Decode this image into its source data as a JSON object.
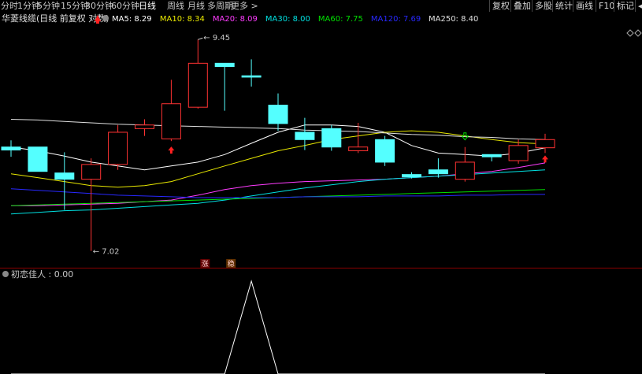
{
  "toolbar": {
    "tabs": [
      "分时",
      "1分钟",
      "5分钟",
      "15分钟",
      "30分钟",
      "60分钟",
      "日线",
      "周线",
      "月线",
      "多周期",
      "更多 >"
    ],
    "active": "日线",
    "right_buttons": [
      "复权",
      "叠加",
      "多股",
      "统计",
      "画线",
      "F10",
      "标记",
      "◀"
    ]
  },
  "chart_data": {
    "type": "candlestick",
    "title": "华菱线缆(日线 前复权 对数)",
    "scale": "log",
    "ylim": [
      6.85,
      10.05
    ],
    "grid": false,
    "candles": [
      {
        "o": 8.3,
        "h": 8.39,
        "l": 8.17,
        "c": 8.26
      },
      {
        "o": 8.3,
        "h": 8.3,
        "l": 7.98,
        "c": 7.98
      },
      {
        "o": 7.96,
        "h": 8.23,
        "l": 7.5,
        "c": 7.88
      },
      {
        "o": 7.88,
        "h": 8.15,
        "l": 7.02,
        "c": 8.07
      },
      {
        "o": 8.07,
        "h": 8.6,
        "l": 8.0,
        "c": 8.5
      },
      {
        "o": 8.55,
        "h": 8.68,
        "l": 8.45,
        "c": 8.6
      },
      {
        "o": 8.41,
        "h": 9.25,
        "l": 8.38,
        "c": 8.9
      },
      {
        "o": 8.85,
        "h": 9.87,
        "l": 8.83,
        "c": 9.5
      },
      {
        "o": 9.5,
        "h": 9.45,
        "l": 8.8,
        "c": 9.45
      },
      {
        "o": 9.31,
        "h": 9.56,
        "l": 9.15,
        "c": 9.29
      },
      {
        "o": 8.88,
        "h": 9.05,
        "l": 8.52,
        "c": 8.62
      },
      {
        "o": 8.5,
        "h": 8.7,
        "l": 8.26,
        "c": 8.4
      },
      {
        "o": 8.55,
        "h": 8.6,
        "l": 8.25,
        "c": 8.3
      },
      {
        "o": 8.25,
        "h": 8.63,
        "l": 8.22,
        "c": 8.3
      },
      {
        "o": 8.4,
        "h": 8.45,
        "l": 8.05,
        "c": 8.1
      },
      {
        "o": 7.94,
        "h": 7.97,
        "l": 7.89,
        "c": 7.91
      },
      {
        "o": 8.0,
        "h": 8.15,
        "l": 7.9,
        "c": 7.95
      },
      {
        "o": 7.88,
        "h": 8.3,
        "l": 7.85,
        "c": 8.1
      },
      {
        "o": 8.2,
        "h": 8.2,
        "l": 8.11,
        "c": 8.17
      },
      {
        "o": 8.12,
        "h": 8.4,
        "l": 8.08,
        "c": 8.32
      },
      {
        "o": 8.29,
        "h": 8.48,
        "l": 8.22,
        "c": 8.4
      }
    ],
    "moving_averages": [
      {
        "name": "MA5",
        "value": "8.29",
        "color": "#ffffff",
        "values": [
          8.3,
          8.25,
          8.18,
          8.1,
          8.05,
          8.0,
          8.05,
          8.1,
          8.2,
          8.35,
          8.5,
          8.6,
          8.6,
          8.58,
          8.5,
          8.32,
          8.22,
          8.2,
          8.18,
          8.22,
          8.29
        ]
      },
      {
        "name": "MA10",
        "value": "8.34",
        "color": "#e8e800",
        "values": [
          7.95,
          7.9,
          7.85,
          7.8,
          7.78,
          7.8,
          7.85,
          7.95,
          8.05,
          8.15,
          8.25,
          8.32,
          8.4,
          8.45,
          8.5,
          8.52,
          8.5,
          8.45,
          8.4,
          8.36,
          8.34
        ]
      },
      {
        "name": "MA20",
        "value": "8.09",
        "color": "#ff3cff",
        "values": [
          7.55,
          7.55,
          7.56,
          7.57,
          7.58,
          7.6,
          7.62,
          7.68,
          7.75,
          7.8,
          7.83,
          7.85,
          7.86,
          7.87,
          7.88,
          7.9,
          7.92,
          7.95,
          7.98,
          8.03,
          8.09
        ]
      },
      {
        "name": "MA30",
        "value": "8.00",
        "color": "#00e0e0",
        "values": [
          7.45,
          7.47,
          7.49,
          7.5,
          7.52,
          7.54,
          7.56,
          7.58,
          7.62,
          7.67,
          7.72,
          7.77,
          7.81,
          7.85,
          7.88,
          7.9,
          7.92,
          7.94,
          7.96,
          7.98,
          8.0
        ]
      },
      {
        "name": "MA60",
        "value": "7.75",
        "color": "#00e000",
        "values": [
          7.55,
          7.56,
          7.57,
          7.58,
          7.59,
          7.6,
          7.61,
          7.62,
          7.63,
          7.64,
          7.65,
          7.66,
          7.67,
          7.68,
          7.69,
          7.7,
          7.71,
          7.72,
          7.73,
          7.74,
          7.75
        ]
      },
      {
        "name": "MA120",
        "value": "7.69",
        "color": "#2828ff",
        "values": [
          7.76,
          7.74,
          7.72,
          7.7,
          7.68,
          7.67,
          7.66,
          7.65,
          7.65,
          7.65,
          7.65,
          7.66,
          7.66,
          7.66,
          7.67,
          7.67,
          7.67,
          7.68,
          7.68,
          7.69,
          7.69
        ]
      },
      {
        "name": "MA250",
        "value": "8.40",
        "color": "#e0e0e0",
        "values": [
          8.68,
          8.67,
          8.65,
          8.63,
          8.61,
          8.6,
          8.59,
          8.58,
          8.57,
          8.56,
          8.55,
          8.53,
          8.52,
          8.51,
          8.49,
          8.47,
          8.46,
          8.44,
          8.43,
          8.41,
          8.4
        ]
      }
    ],
    "annotations": {
      "max_label": "9.45",
      "min_label": "7.02",
      "badge_rise": "涨",
      "badge_steady": "稳"
    },
    "indicator": {
      "name": "初恋佳人",
      "value": "0.00",
      "values": [
        0,
        0,
        0,
        0,
        0,
        0,
        0,
        0,
        0,
        1,
        0,
        0,
        0,
        0,
        0,
        0,
        0,
        0,
        0,
        0,
        0
      ],
      "ylim": [
        0,
        1
      ]
    }
  }
}
